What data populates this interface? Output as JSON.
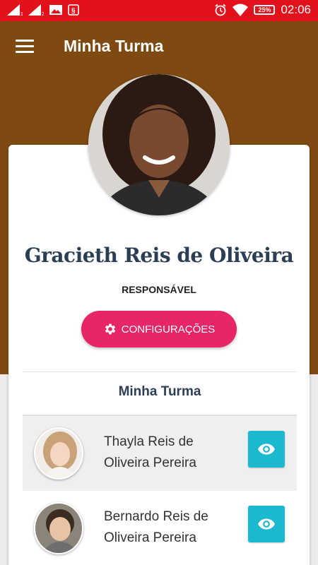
{
  "status_bar": {
    "time": "02:06",
    "battery": "25%",
    "icons": [
      "signal-1-icon",
      "signal-2-icon",
      "image-icon",
      "notification-icon",
      "alarm-icon",
      "wifi-icon",
      "battery-icon"
    ]
  },
  "app_bar": {
    "title": "Minha Turma",
    "menu_icon": "menu-icon"
  },
  "profile": {
    "name": "Gracieth Reis de Oliveira",
    "role": "RESPONSÁVEL",
    "config_button_label": "CONFIGURAÇÕES",
    "config_icon": "gear-icon"
  },
  "section": {
    "title": "Minha Turma"
  },
  "students": [
    {
      "name": "Thayla Reis de Oliveira Pereira",
      "action_icon": "eye-icon"
    },
    {
      "name": "Bernardo Reis de Oliveira Pereira",
      "action_icon": "eye-icon"
    }
  ],
  "colors": {
    "status_bar": "#e3111b",
    "app_bar": "#7f4a11",
    "config_button": "#e72567",
    "view_button": "#1bb8cf",
    "name_text": "#2c3e55"
  }
}
